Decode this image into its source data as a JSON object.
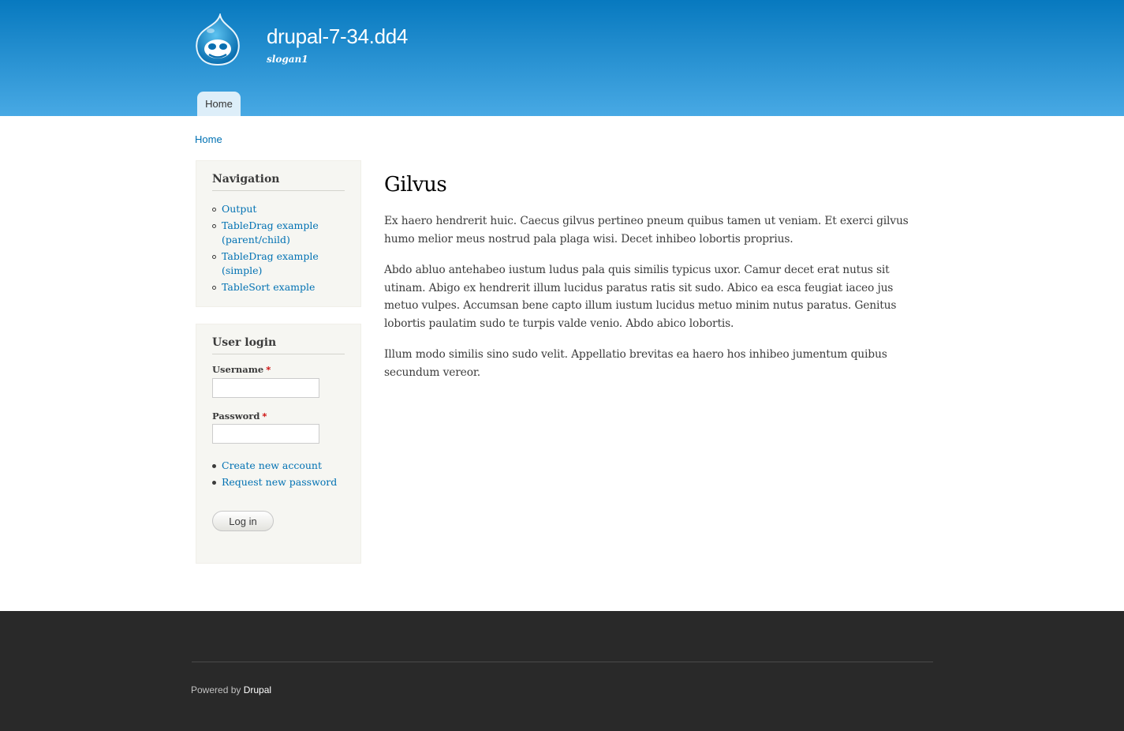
{
  "header": {
    "site_name": "drupal-7-34.dd4",
    "slogan": "slogan1",
    "logo_icon": "drupal-drop-logo",
    "menu": [
      {
        "label": "Home"
      }
    ]
  },
  "breadcrumb": {
    "home": "Home"
  },
  "sidebar": {
    "navigation": {
      "title": "Navigation",
      "items": [
        {
          "label": "Output"
        },
        {
          "label": "TableDrag example (parent/child)"
        },
        {
          "label": "TableDrag example (simple)"
        },
        {
          "label": "TableSort example"
        }
      ]
    },
    "user_login": {
      "title": "User login",
      "username_label": "Username",
      "password_label": "Password",
      "required_marker": "*",
      "username_value": "",
      "password_value": "",
      "links": [
        {
          "label": "Create new account"
        },
        {
          "label": "Request new password"
        }
      ],
      "submit_label": "Log in"
    }
  },
  "content": {
    "title": "Gilvus",
    "paragraphs": [
      "Ex haero hendrerit huic. Caecus gilvus pertineo pneum quibus tamen ut veniam. Et exerci gilvus humo melior meus nostrud pala plaga wisi. Decet inhibeo lobortis proprius.",
      "Abdo abluo antehabeo iustum ludus pala quis similis typicus uxor. Camur decet erat nutus sit utinam. Abigo ex hendrerit illum lucidus paratus ratis sit sudo. Abico ea esca feugiat iaceo jus metuo vulpes. Accumsan bene capto illum iustum lucidus metuo minim nutus paratus. Genitus lobortis paulatim sudo te turpis valde venio. Abdo abico lobortis.",
      "Illum modo similis sino sudo velit. Appellatio brevitas ea haero hos inhibeo jumentum quibus secundum vereor."
    ]
  },
  "footer": {
    "powered_prefix": "Powered by",
    "powered_link": "Drupal"
  },
  "colors": {
    "header_top": "#0779bf",
    "header_bottom": "#48a9e4",
    "link": "#0071b3",
    "footer_bg": "#292929",
    "sidebar_bg": "#f6f6f2"
  }
}
